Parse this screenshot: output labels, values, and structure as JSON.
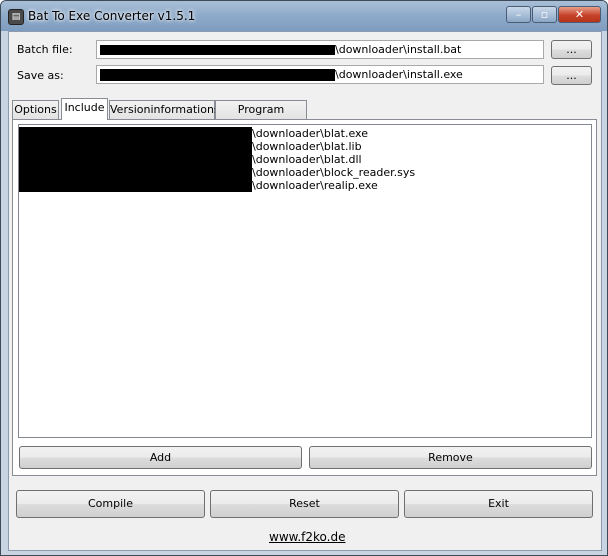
{
  "window": {
    "title": "Bat To Exe Converter v1.5.1"
  },
  "caption_buttons": {
    "minimize": "–",
    "maximize": "▫",
    "close": "✕"
  },
  "form": {
    "batch_label": "Batch file:",
    "batch_value": "\\downloader\\install.bat",
    "saveas_label": "Save as:",
    "saveas_value": "\\downloader\\install.exe",
    "browse_label": "..."
  },
  "tabs": [
    "Options",
    "Include",
    "Versioninformations",
    "Program settings"
  ],
  "include": {
    "files": [
      "\\downloader\\blat.exe",
      "\\downloader\\blat.lib",
      "\\downloader\\blat.dll",
      "\\downloader\\block_reader.sys",
      "\\downloader\\realip.exe"
    ],
    "add_label": "Add",
    "remove_label": "Remove"
  },
  "actions": {
    "compile": "Compile",
    "reset": "Reset",
    "exit": "Exit"
  },
  "footer_link": "www.f2ko.de"
}
